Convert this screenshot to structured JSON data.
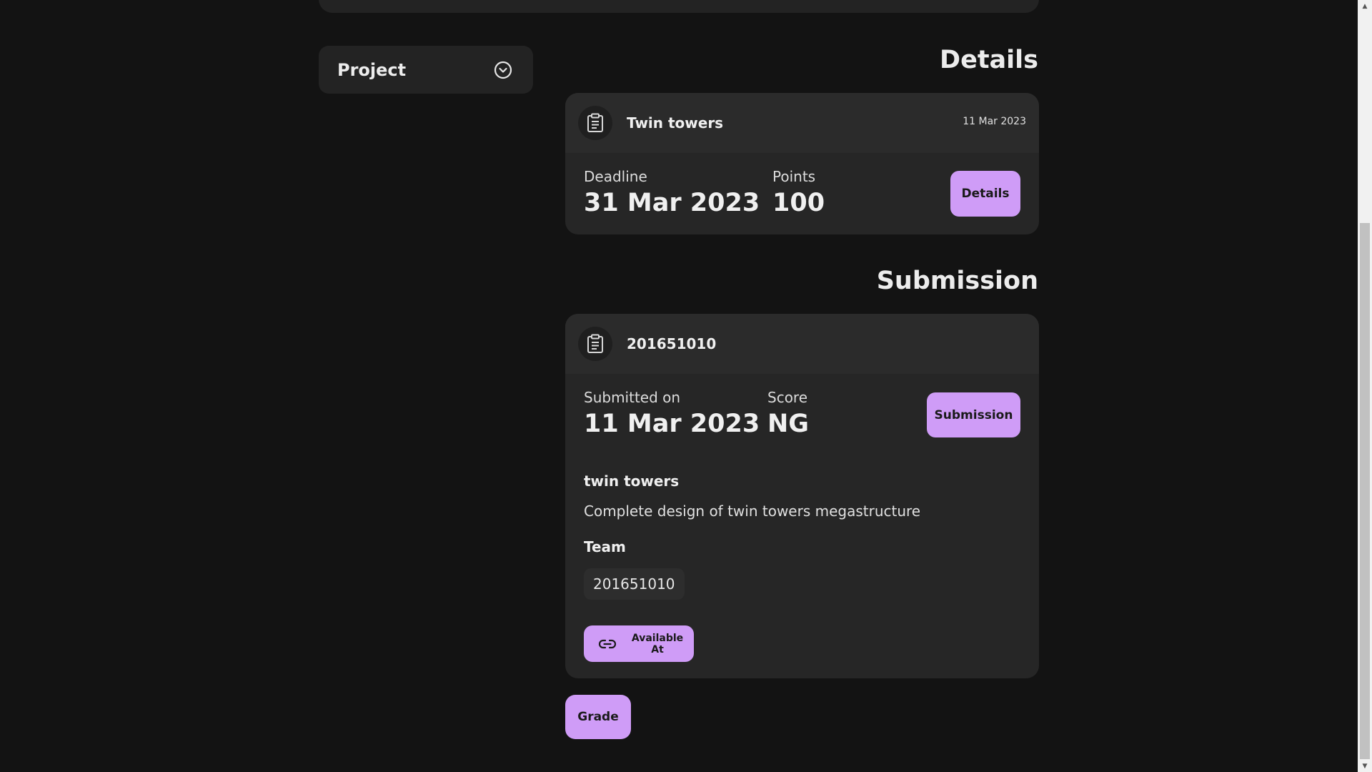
{
  "sidebar": {
    "project_label": "Project"
  },
  "details_section": {
    "title": "Details",
    "card": {
      "title": "Twin towers",
      "date": "11 Mar 2023",
      "deadline_label": "Deadline",
      "deadline_value": "31 Mar 2023",
      "points_label": "Points",
      "points_value": "100",
      "button_label": "Details"
    }
  },
  "submission_section": {
    "title": "Submission",
    "card": {
      "title": "201651010",
      "submitted_label": "Submitted on",
      "submitted_value": "11 Mar 2023",
      "score_label": "Score",
      "score_value": "NG",
      "button_label": "Submission",
      "submission_title": "twin towers",
      "submission_description": "Complete design of twin towers megastructure",
      "team_label": "Team",
      "team_members": [
        "201651010"
      ],
      "available_label": "Available At"
    }
  },
  "actions": {
    "grade_label": "Grade"
  },
  "colors": {
    "background": "#131313",
    "card": "#262626",
    "accent": "#cf9cf7"
  },
  "icons": {
    "dropdown": "chevron-down-circle-icon",
    "card_header": "clipboard-icon",
    "link": "link-icon"
  }
}
